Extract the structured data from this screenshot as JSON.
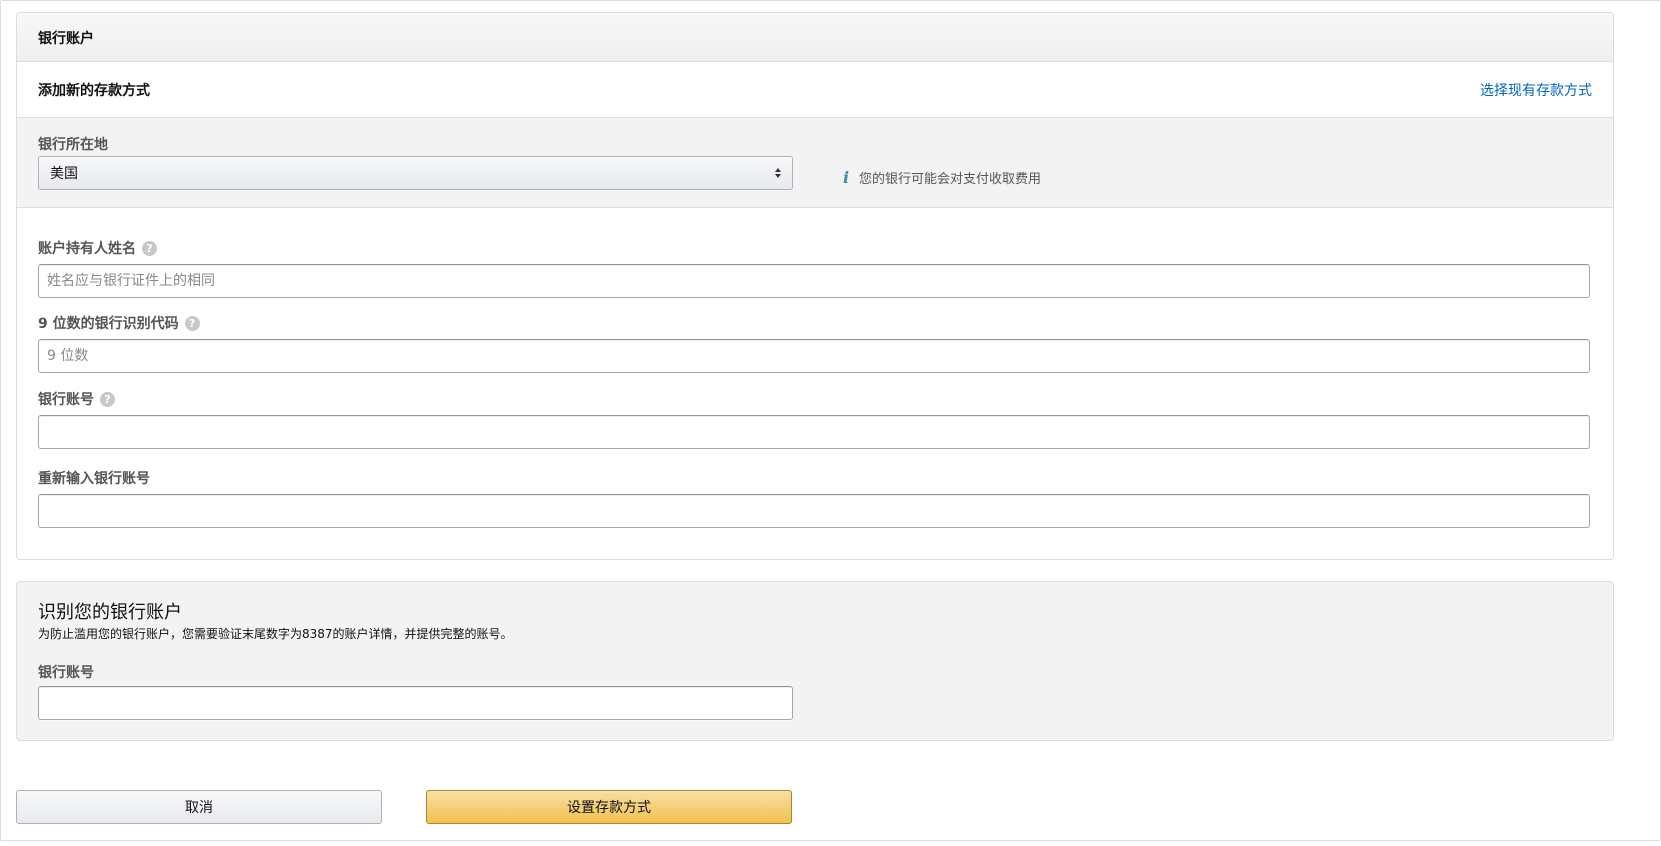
{
  "card": {
    "title": "银行账户",
    "add_title": "添加新的存款方式",
    "select_existing_link": "选择现有存款方式"
  },
  "location": {
    "label": "银行所在地",
    "selected": "美国",
    "fee_note": "您的银行可能会对支付收取费用"
  },
  "fields": {
    "holder": {
      "label": "账户持有人姓名",
      "placeholder": "姓名应与银行证件上的相同",
      "value": ""
    },
    "routing": {
      "label": "9 位数的银行识别代码",
      "placeholder": "9 位数",
      "value": ""
    },
    "account": {
      "label": "银行账号",
      "placeholder": "",
      "value": ""
    },
    "account_confirm": {
      "label": "重新输入银行账号",
      "placeholder": "",
      "value": ""
    }
  },
  "verify": {
    "title": "识别您的银行账户",
    "description": "为防止滥用您的银行账户，您需要验证末尾数字为8387的账户详情，并提供完整的账号。",
    "label": "银行账号",
    "value": ""
  },
  "buttons": {
    "cancel": "取消",
    "submit": "设置存款方式"
  },
  "icons": {
    "help": "question-circle-icon",
    "info": "info-icon",
    "select_arrow": "select-arrows-icon"
  },
  "colors": {
    "link": "#0066c0",
    "primary_button": "#f0c14b",
    "panel_bg": "#f3f3f3",
    "info": "#3a8ca3"
  }
}
